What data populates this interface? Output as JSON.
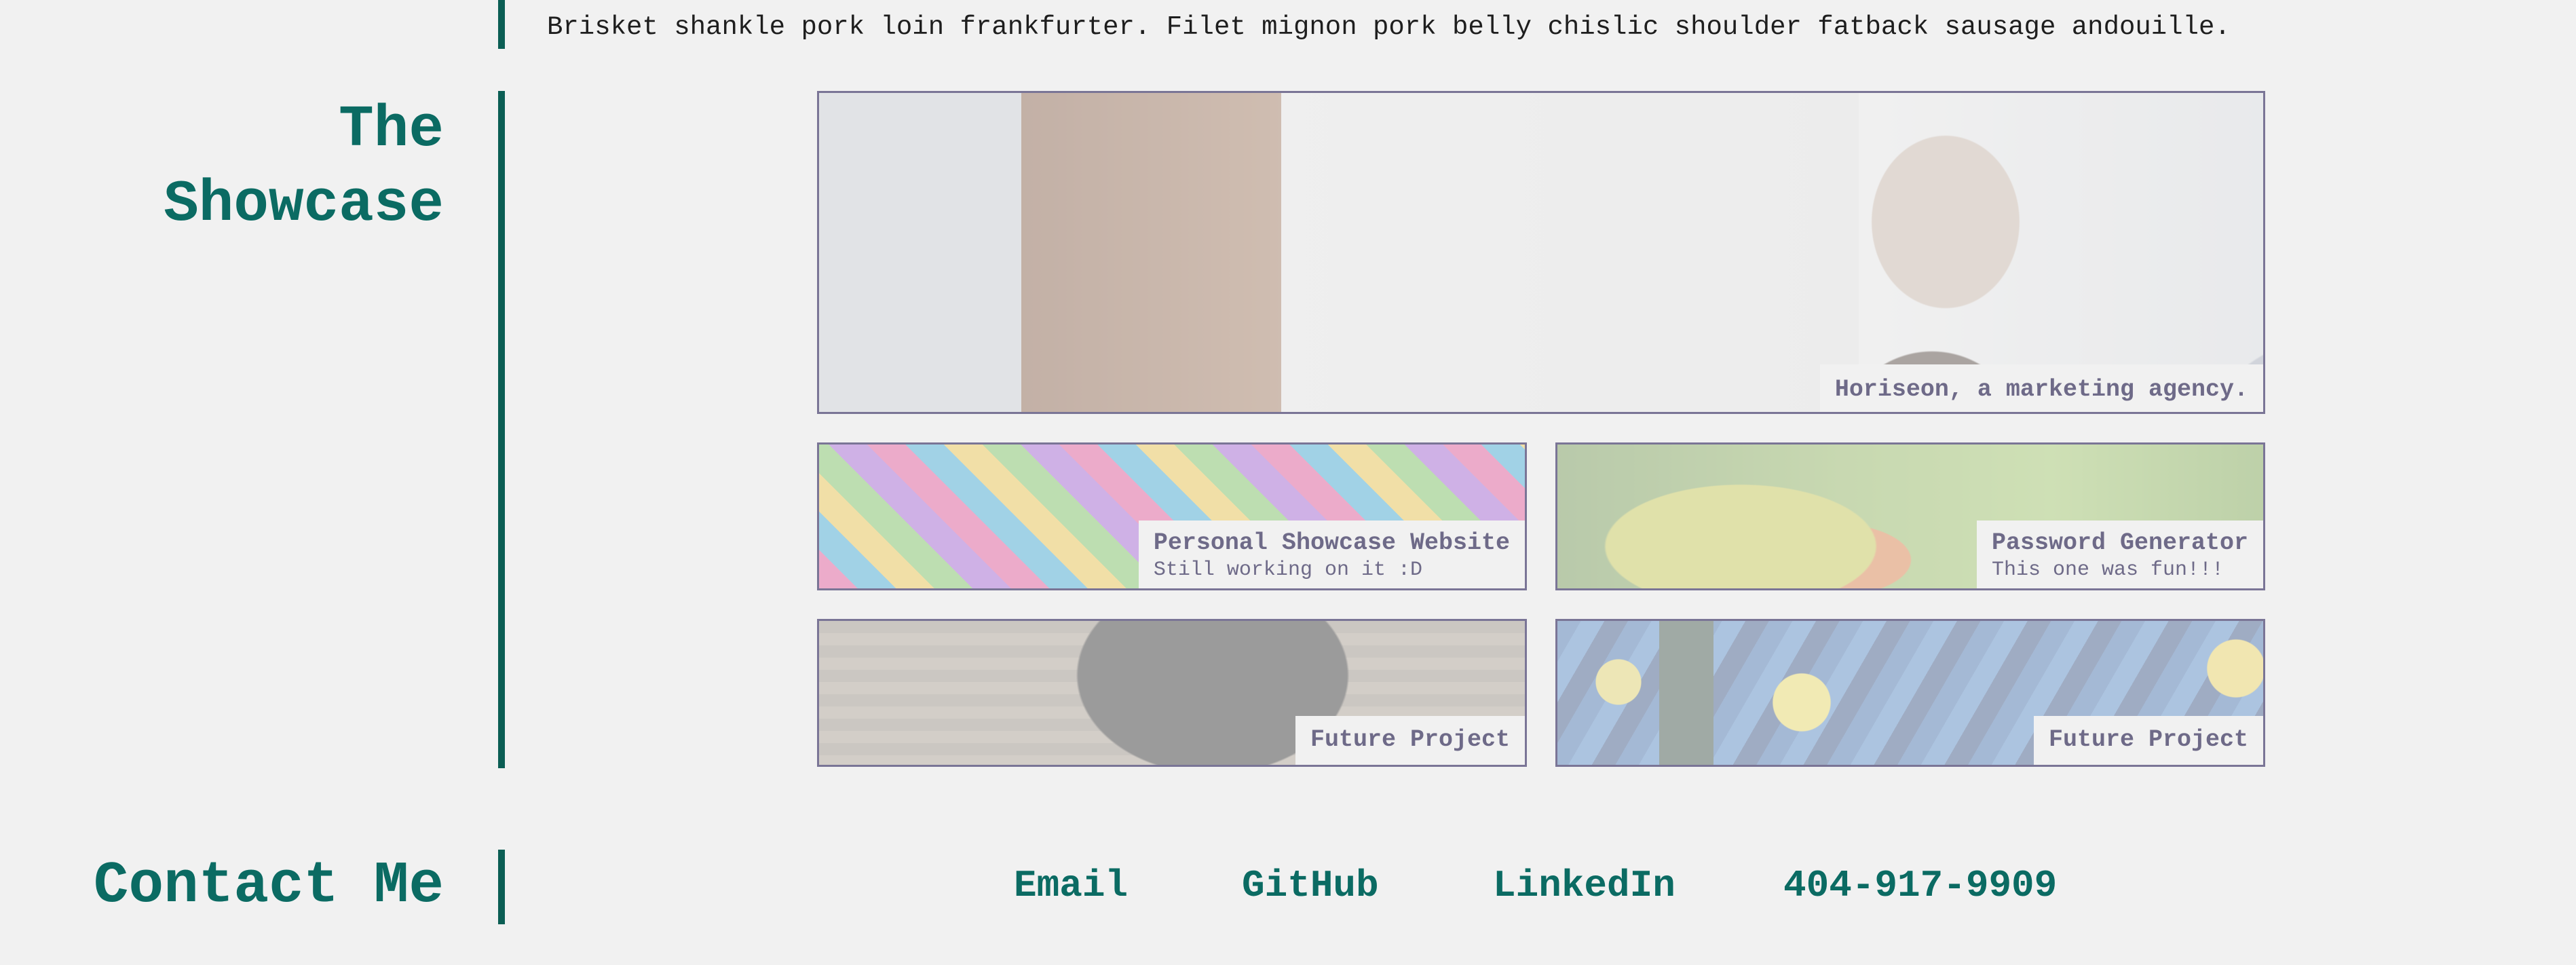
{
  "intro": {
    "text": "Brisket shankle pork loin frankfurter. Filet mignon pork belly chislic shoulder fatback sausage andouille."
  },
  "showcase": {
    "heading_line1": "The",
    "heading_line2": "Showcase",
    "hero": {
      "caption": "Horiseon, a marketing agency."
    },
    "projects": [
      {
        "title": "Personal Showcase Website",
        "subtitle": "Still working on it :D"
      },
      {
        "title": "Password Generator",
        "subtitle": "This one was fun!!!"
      },
      {
        "title": "Future Project",
        "subtitle": ""
      },
      {
        "title": "Future Project",
        "subtitle": ""
      }
    ]
  },
  "contact": {
    "heading": "Contact Me",
    "links": [
      {
        "label": "Email"
      },
      {
        "label": "GitHub"
      },
      {
        "label": "LinkedIn"
      },
      {
        "label": "404-917-9909"
      }
    ]
  },
  "colors": {
    "background": "#f1f1f1",
    "accent": "#0b6b63",
    "rule": "#0b5e54",
    "card_border": "#7a7596",
    "caption_text": "#6e6a88"
  }
}
